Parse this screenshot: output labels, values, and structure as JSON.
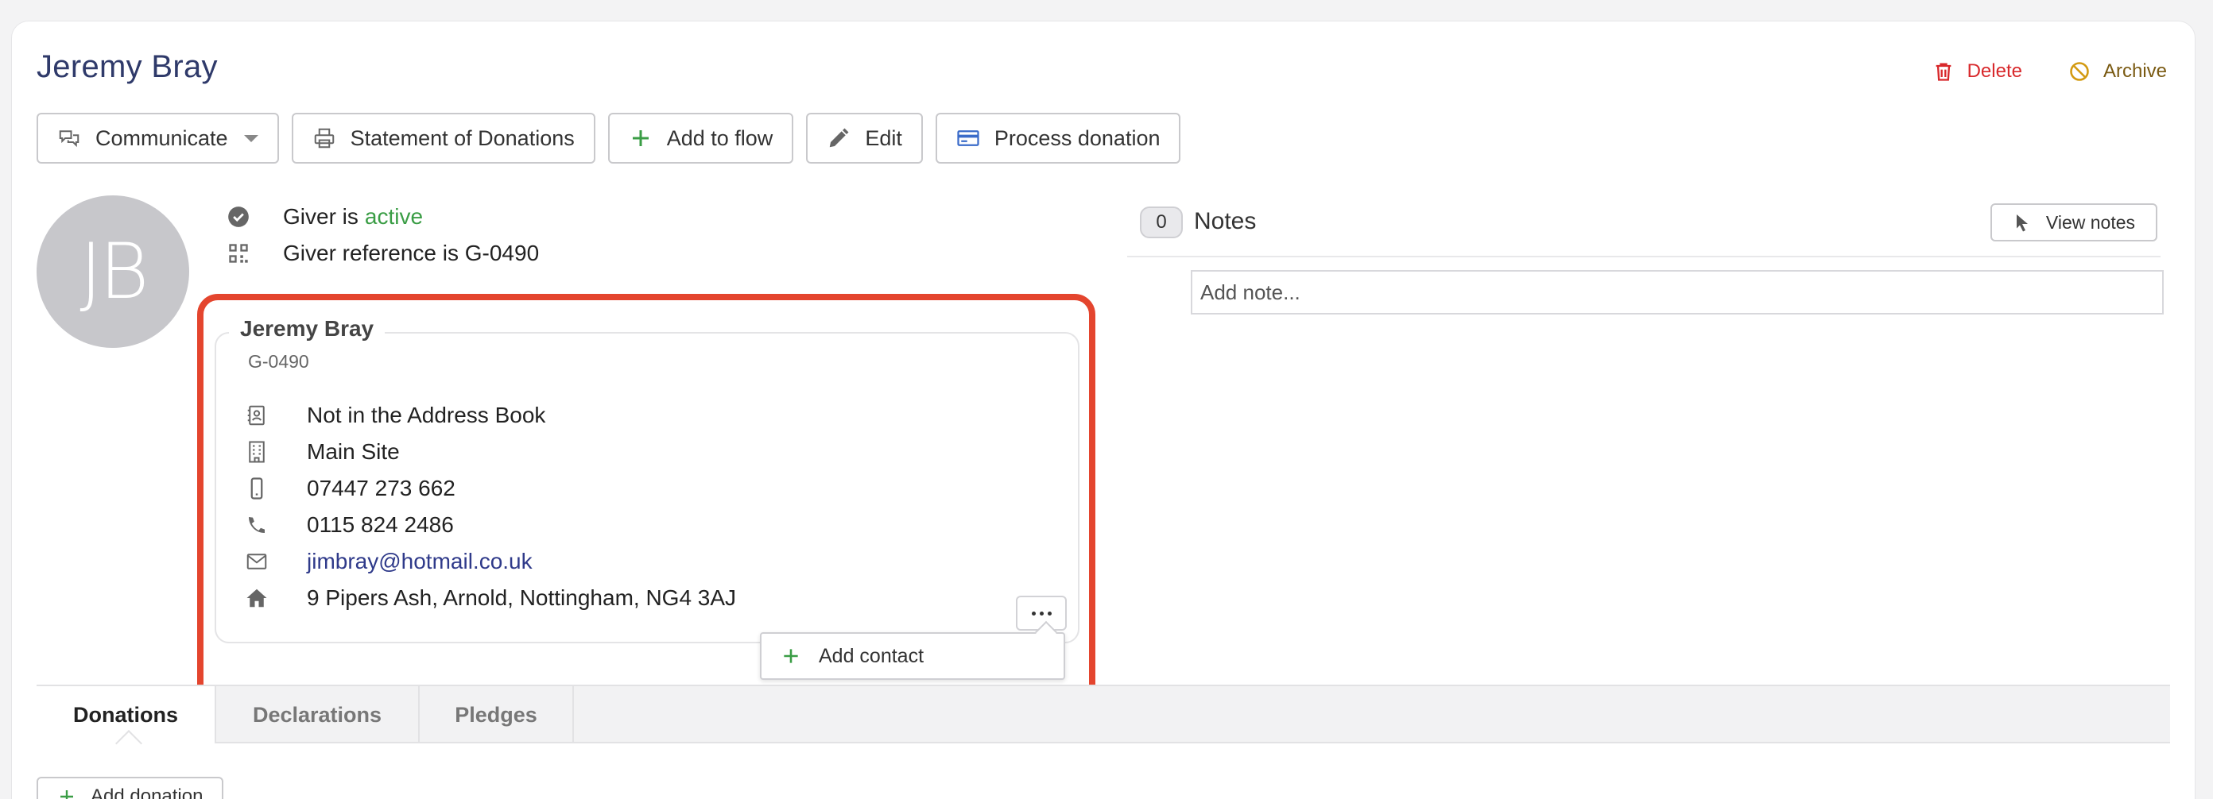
{
  "giver": {
    "name": "Jeremy Bray",
    "initials": "JB",
    "status_prefix": "Giver is",
    "status": "active",
    "reference_text": "Giver reference is G-0490"
  },
  "header_actions": {
    "delete_label": "Delete",
    "archive_label": "Archive"
  },
  "toolbar": {
    "communicate_label": "Communicate",
    "statement_label": "Statement of Donations",
    "add_to_flow_label": "Add to flow",
    "edit_label": "Edit",
    "process_donation_label": "Process donation"
  },
  "contact_card": {
    "name": "Jeremy Bray",
    "ref": "G-0490",
    "items": [
      {
        "icon": "address-book-icon",
        "text": "Not in the Address Book"
      },
      {
        "icon": "building-icon",
        "text": "Main Site"
      },
      {
        "icon": "mobile-phone-icon",
        "text": "07447 273 662"
      },
      {
        "icon": "phone-icon",
        "text": "0115 824 2486"
      },
      {
        "icon": "envelope-icon",
        "text": "jimbray@hotmail.co.uk"
      },
      {
        "icon": "home-icon",
        "text": "9 Pipers Ash, Arnold, Nottingham, NG4 3AJ"
      }
    ],
    "add_contact_label": "Add contact"
  },
  "notes": {
    "count": "0",
    "title": "Notes",
    "view_label": "View notes",
    "placeholder": "Add note..."
  },
  "tabs": [
    "Donations",
    "Declarations",
    "Pledges"
  ],
  "add_donation_label": "Add donation",
  "colors": {
    "title": "#2f3a6a",
    "active": "#3a9d45",
    "delete": "#d8282b",
    "archive": "#7a5a12",
    "highlight": "#e4452e",
    "email": "#2f3a8a"
  }
}
